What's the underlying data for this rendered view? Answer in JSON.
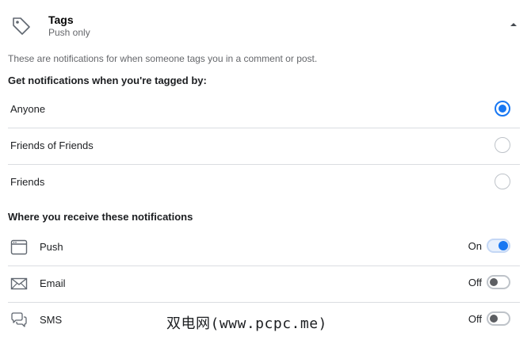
{
  "header": {
    "title": "Tags",
    "subtitle": "Push only",
    "icon": "tag-icon",
    "collapse_icon": "caret-up-icon"
  },
  "description": "These are notifications for when someone tags you in a comment or post.",
  "tagged_by": {
    "heading": "Get notifications when you're tagged by:",
    "options": [
      {
        "label": "Anyone",
        "selected": true
      },
      {
        "label": "Friends of Friends",
        "selected": false
      },
      {
        "label": "Friends",
        "selected": false
      }
    ]
  },
  "channels": {
    "heading": "Where you receive these notifications",
    "items": [
      {
        "label": "Push",
        "state": "On",
        "enabled": true,
        "icon": "browser-window-icon"
      },
      {
        "label": "Email",
        "state": "Off",
        "enabled": false,
        "icon": "envelope-icon"
      },
      {
        "label": "SMS",
        "state": "Off",
        "enabled": false,
        "icon": "chat-bubbles-icon"
      }
    ]
  },
  "colors": {
    "accent": "#1877f2",
    "secondary_text": "#65676b",
    "divider": "#dadde1"
  },
  "watermark": "双电网(www.pcpc.me)"
}
